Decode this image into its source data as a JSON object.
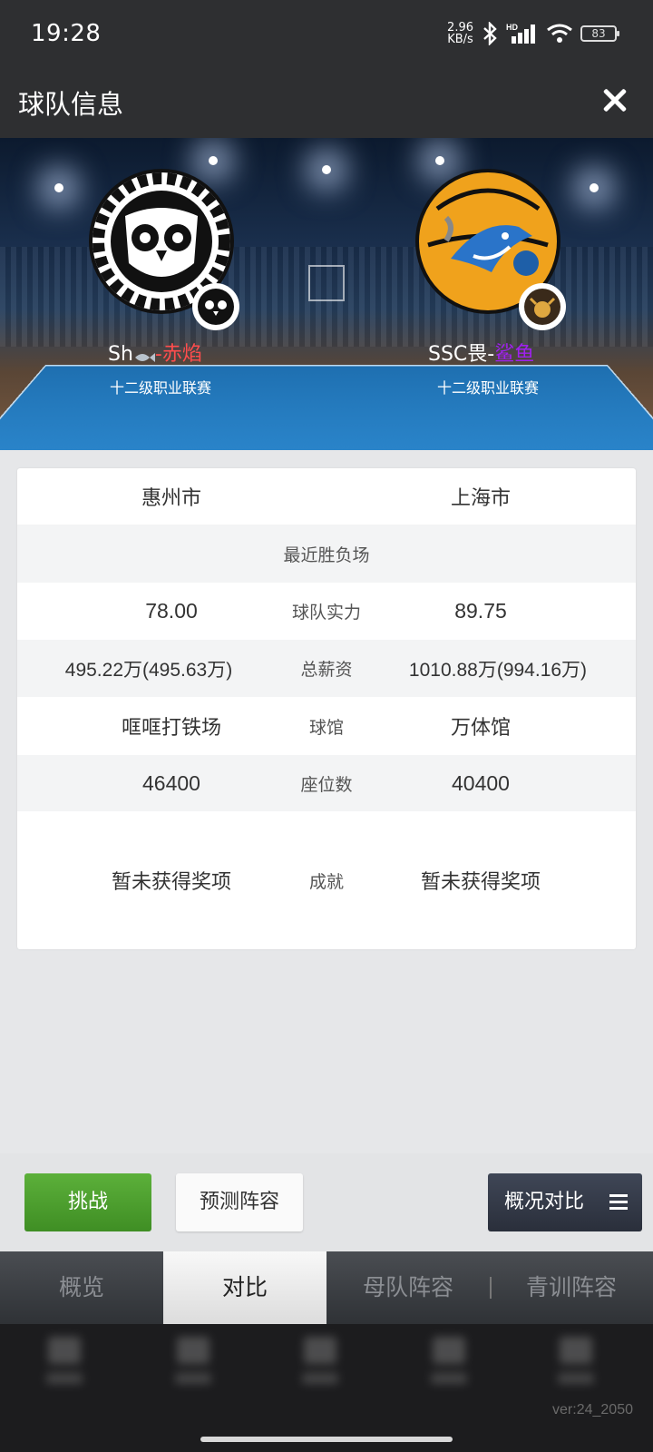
{
  "status_bar": {
    "time": "19:28",
    "net_speed_value": "2.96",
    "net_speed_unit": "KB/s",
    "battery": "83"
  },
  "header": {
    "title": "球队信息"
  },
  "banner": {
    "team_a": {
      "name_prefix": "Sh",
      "name_suffix": "-赤焰",
      "league": "十二级职业联赛"
    },
    "team_b": {
      "name_prefix": "SSC畏-",
      "name_suffix": "鲨鱼",
      "league": "十二级职业联赛"
    }
  },
  "table": {
    "city_left": "惠州市",
    "city_right": "上海市",
    "recent_label": "最近胜负场",
    "strength_left": "78.00",
    "strength_label": "球队实力",
    "strength_right": "89.75",
    "salary_left": "495.22万(495.63万)",
    "salary_label": "总薪资",
    "salary_right": "1010.88万(994.16万)",
    "arena_left": "哐哐打铁场",
    "arena_label": "球馆",
    "arena_right": "万体馆",
    "seats_left": "46400",
    "seats_label": "座位数",
    "seats_right": "40400",
    "achievement_left": "暂未获得奖项",
    "achievement_label": "成就",
    "achievement_right": "暂未获得奖项"
  },
  "actions": {
    "challenge": "挑战",
    "predict_lineup": "预测阵容",
    "overview_compare": "概况对比"
  },
  "tabs": [
    {
      "label": "概览"
    },
    {
      "label": "对比"
    },
    {
      "label": "母队阵容"
    },
    {
      "label": "青训阵容"
    }
  ],
  "footer": {
    "version": "ver:24_2050"
  },
  "colors": {
    "header_bg": "#2e2f31",
    "challenge_green": "#4fa02e",
    "team_a_accent": "#ff4d4d",
    "team_b_accent": "#a020f0"
  }
}
